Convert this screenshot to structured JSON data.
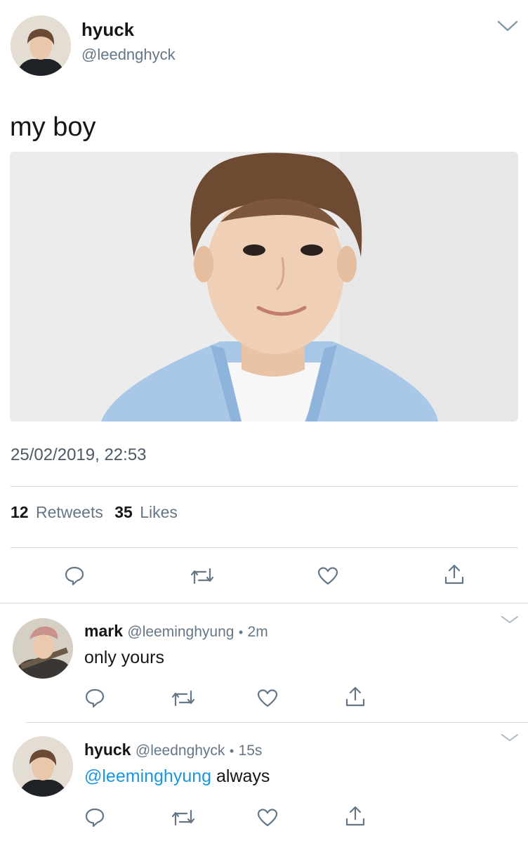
{
  "tweet": {
    "author_name": "hyuck",
    "author_handle": "@leednghyck",
    "text": "my boy",
    "timestamp": "25/02/2019, 22:53",
    "retweet_count": "12",
    "retweet_label": "Retweets",
    "like_count": "35",
    "like_label": "Likes"
  },
  "replies": [
    {
      "name": "mark",
      "handle": "@leeminghyung",
      "separator": "•",
      "age": "2m",
      "text": "only yours"
    },
    {
      "name": "hyuck",
      "handle": "@leednghyck",
      "separator": "•",
      "age": "15s",
      "mention": "@leeminghyung",
      "text": " always"
    }
  ],
  "colors": {
    "text": "#14171a",
    "secondary": "#657786",
    "link": "#1b95e0",
    "divider": "#d9dde1"
  },
  "icons": [
    "chevron-down-icon",
    "reply-icon",
    "retweet-icon",
    "like-icon",
    "share-icon"
  ]
}
